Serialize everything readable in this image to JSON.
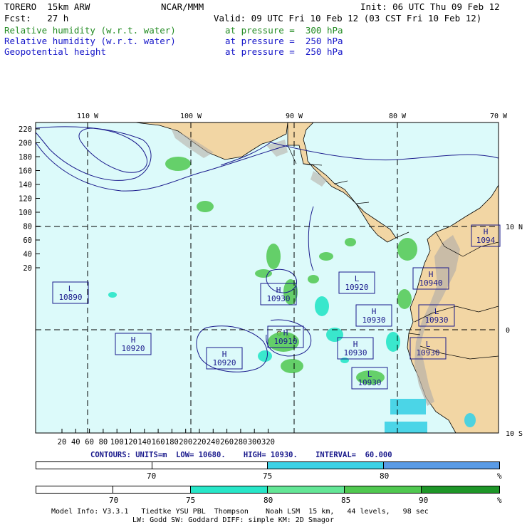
{
  "header": {
    "model": "TORERO  15km ARW",
    "org": "NCAR/MMM",
    "init": "Init: 06 UTC Thu 09 Feb 12",
    "fcst": "Fcst:   27 h",
    "valid": "Valid: 09 UTC Fri 10 Feb 12 (03 CST Fri 10 Feb 12)",
    "fields": [
      {
        "name": "Relative humidity (w.r.t. water)",
        "level": "at pressure =  300 hPa",
        "color": "#228b22"
      },
      {
        "name": "Relative humidity (w.r.t. water)",
        "level": "at pressure =  250 hPa",
        "color": "#1414c8"
      },
      {
        "name": "Geopotential height",
        "level": "at pressure =  250 hPa",
        "color": "#1414c8"
      }
    ]
  },
  "map": {
    "lon_labels": [
      "110 W",
      "100 W",
      "90 W",
      "80 W",
      "70 W"
    ],
    "lat_labels": [
      "10 N",
      "0",
      "10 S"
    ],
    "y_ticks": [
      "220",
      "200",
      "180",
      "160",
      "140",
      "120",
      "100",
      "80",
      "60",
      "40",
      "20"
    ],
    "x_ticks": [
      "20",
      "40",
      "60",
      "80",
      "100",
      "120",
      "140",
      "160",
      "180",
      "200",
      "220",
      "240",
      "260",
      "280",
      "300",
      "320"
    ],
    "ocean_color": "#dcfafa",
    "land_color": "#f2d6a4",
    "centers": [
      {
        "type": "L",
        "value": "10890"
      },
      {
        "type": "H",
        "value": "10920"
      },
      {
        "type": "H",
        "value": "10920"
      },
      {
        "type": "H",
        "value": "10930"
      },
      {
        "type": "H",
        "value": "10910"
      },
      {
        "type": "L",
        "value": "10920"
      },
      {
        "type": "H",
        "value": "10930"
      },
      {
        "type": "H",
        "value": "10930"
      },
      {
        "type": "H",
        "value": "10940"
      },
      {
        "type": "L",
        "value": "10930"
      },
      {
        "type": "L",
        "value": "10930"
      },
      {
        "type": "L",
        "value": "10930"
      },
      {
        "type": "H",
        "value": "1094"
      }
    ]
  },
  "contours": "CONTOURS: UNITS=m  LOW= 10680.    HIGH= 10930.    INTERVAL=  60.000",
  "bar1": {
    "labels": [
      "70",
      "75",
      "80",
      "%"
    ],
    "colors": [
      "#ffffff",
      "#ffffff",
      "#3cd2e6",
      "#5a9be6"
    ]
  },
  "bar2": {
    "labels": [
      "70",
      "75",
      "80",
      "85",
      "90",
      "%"
    ],
    "colors": [
      "#ffffff",
      "#ffffff",
      "#28e6c8",
      "#64e696",
      "#50c850",
      "#1e9628"
    ]
  },
  "footer": {
    "line1": "Model Info: V3.3.1   Tiedtke YSU PBL  Thompson    Noah LSM  15 km,   44 levels,   98 sec",
    "line2": "LW: Godd SW: Goddard DIFF: simple KM: 2D Smagor"
  }
}
